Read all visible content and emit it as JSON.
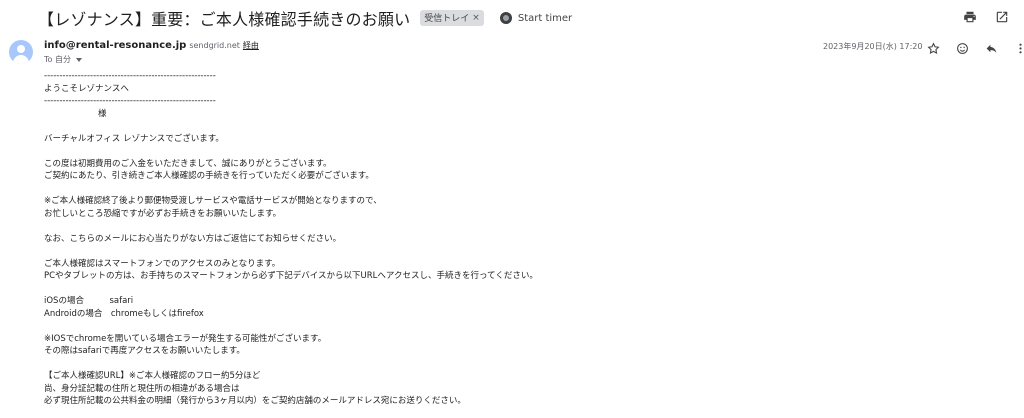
{
  "email": {
    "subject": "【レゾナンス】重要：ご本人様確認手続きのお願い",
    "label": "受信トレイ",
    "label_remove": "×",
    "timer_label": "Start timer",
    "sender_email": "info@rental-resonance.jp",
    "via_domain": "sendgrid.net",
    "via_label": "経由",
    "to_label": "To 自分",
    "date": "2023年9月20日(水) 17:20"
  },
  "icons": {
    "print": "print-icon",
    "open_new_window": "open-in-new-window-icon",
    "star": "star-icon",
    "emoji": "emoji-reaction-icon",
    "reply": "reply-icon",
    "more": "more-vert-icon",
    "avatar": "avatar-person-icon"
  },
  "body_lines": [
    "--------------------------------------------------------",
    "ようこそレゾナンスへ",
    "--------------------------------------------------------",
    "                    様",
    "",
    "バーチャルオフィス レゾナンスでございます。",
    "",
    "この度は初期費用のご入金をいただきまして、誠にありがとうございます。",
    "ご契約にあたり、引き続きご本人様確認の手続きを行っていただく必要がございます。",
    "",
    "※ご本人様確認終了後より郵便物受渡しサービスや電話サービスが開始となりますので、",
    "お忙しいところ恐縮ですが必ずお手続きをお願いいたします。",
    "",
    "なお、こちらのメールにお心当たりがない方はご返信にてお知らせください。",
    "",
    "ご本人様確認はスマートフォンでのアクセスのみとなります。",
    "PCやタブレットの方は、お手持ちのスマートフォンから必ず下記デバイスから以下URLへアクセスし、手続きを行ってください。",
    "",
    "iOSの場合　　　safari",
    "Androidの場合　chromeもしくはfirefox",
    "",
    "※IOSでchromeを開いている場合エラーが発生する可能性がございます。",
    "その際はsafariで再度アクセスをお願いいたします。",
    "",
    "【ご本人様確認URL】※ご本人様確認のフロー約5分ほど",
    "尚、身分証記載の住所と現住所の相違がある場合は",
    "必ず現住所記載の公共料金の明細（発行から3ヶ月以内）をご契約店舗のメールアドレス宛にお送りください。"
  ]
}
